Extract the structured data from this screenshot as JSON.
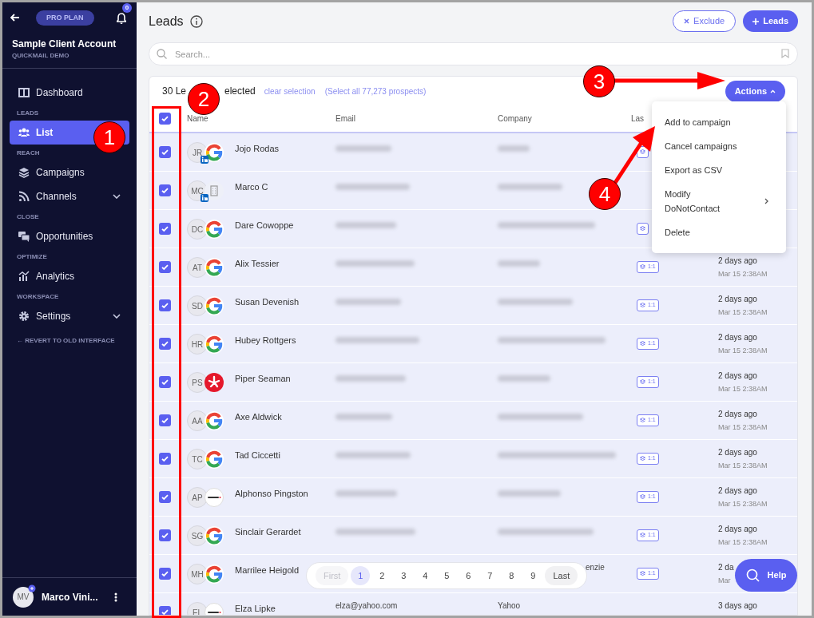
{
  "sidebar": {
    "plan": "PRO PLAN",
    "notifications": "0",
    "account": "Sample Client Account",
    "workspace": "QUICKMAIL DEMO",
    "sections": [
      {
        "items": [
          {
            "kind": "dashboard",
            "label": "Dashboard",
            "selected": false,
            "expandable": false
          }
        ]
      },
      {
        "heading": "LEADS",
        "items": [
          {
            "kind": "list",
            "label": "List",
            "selected": true,
            "expandable": false
          }
        ]
      },
      {
        "heading": "REACH",
        "items": [
          {
            "kind": "campaigns",
            "label": "Campaigns",
            "selected": false,
            "expandable": false
          },
          {
            "kind": "channels",
            "label": "Channels",
            "selected": false,
            "expandable": true
          }
        ]
      },
      {
        "heading": "CLOSE",
        "items": [
          {
            "kind": "opportunities",
            "label": "Opportunities",
            "selected": false,
            "expandable": false
          }
        ]
      },
      {
        "heading": "OPTIMIZE",
        "items": [
          {
            "kind": "analytics",
            "label": "Analytics",
            "selected": false,
            "expandable": false
          }
        ]
      },
      {
        "heading": "WORKSPACE",
        "items": [
          {
            "kind": "settings",
            "label": "Settings",
            "selected": false,
            "expandable": true
          }
        ]
      }
    ],
    "revert_link": "← REVERT TO OLD INTERFACE",
    "user": {
      "initials": "MV",
      "name": "Marco Vini..."
    }
  },
  "page": {
    "title": "Leads",
    "exclude_button": "Exclude",
    "add_button": "Leads",
    "search": {
      "placeholder": "Search..."
    }
  },
  "table": {
    "selection_text": [
      "30 Le",
      "elected"
    ],
    "clear_link": "clear selection",
    "select_all_link": "(Select all 77,273 prospects)",
    "actions_button": "Actions",
    "all_checked": true,
    "columns": [
      "Name",
      "Email",
      "Company",
      "Las"
    ],
    "rows": [
      {
        "checked": true,
        "initials": "JR",
        "name": "Jojo Rodas",
        "logo": {
          "kind": "google"
        },
        "linkedin": true,
        "has_badge": true
      },
      {
        "checked": true,
        "initials": "MC",
        "name": "Marco C",
        "logo": {
          "kind": "building"
        },
        "linkedin": true,
        "has_badge": false
      },
      {
        "checked": true,
        "initials": "DC",
        "name": "Dare Cowoppe",
        "logo": {
          "kind": "google"
        },
        "linkedin": false,
        "has_badge": true
      },
      {
        "checked": true,
        "initials": "AT",
        "name": "Alix Tessier",
        "logo": {
          "kind": "google"
        },
        "linkedin": false,
        "has_badge": true,
        "badge": "1:1",
        "date": "2 days ago",
        "time": "Mar 15 2:38AM"
      },
      {
        "checked": true,
        "initials": "SD",
        "name": "Susan Devenish",
        "logo": {
          "kind": "google"
        },
        "linkedin": false,
        "has_badge": true,
        "badge": "1:1",
        "date": "2 days ago",
        "time": "Mar 15 2:38AM"
      },
      {
        "checked": true,
        "initials": "HR",
        "name": "Hubey Rottgers",
        "logo": {
          "kind": "google"
        },
        "linkedin": false,
        "has_badge": true,
        "badge": "1:1",
        "date": "2 days ago",
        "time": "Mar 15 2:38AM"
      },
      {
        "checked": true,
        "initials": "PS",
        "name": "Piper Seaman",
        "logo": {
          "kind": "yelp"
        },
        "linkedin": false,
        "has_badge": true,
        "badge": "1:1",
        "date": "2 days ago",
        "time": "Mar 15 2:38AM"
      },
      {
        "checked": true,
        "initials": "AA",
        "name": "Axe Aldwick",
        "logo": {
          "kind": "google"
        },
        "linkedin": false,
        "has_badge": true,
        "badge": "1:1",
        "date": "2 days ago",
        "time": "Mar 15 2:38AM"
      },
      {
        "checked": true,
        "initials": "TC",
        "name": "Tad Ciccetti",
        "logo": {
          "kind": "google"
        },
        "linkedin": false,
        "has_badge": true,
        "badge": "1:1",
        "date": "2 days ago",
        "time": "Mar 15 2:38AM"
      },
      {
        "checked": true,
        "initials": "AP",
        "name": "Alphonso Pingston",
        "logo": {
          "kind": "web"
        },
        "linkedin": false,
        "has_badge": true,
        "badge": "1:1",
        "date": "2 days ago",
        "time": "Mar 15 2:38AM"
      },
      {
        "checked": true,
        "initials": "SG",
        "name": "Sinclair Gerardet",
        "logo": {
          "kind": "google"
        },
        "linkedin": false,
        "has_badge": true,
        "badge": "1:1",
        "date": "2 days ago",
        "time": "Mar 15 2:38AM"
      },
      {
        "checked": true,
        "initials": "MH",
        "name": "Marrilee Heigold",
        "logo": {
          "kind": "google"
        },
        "linkedin": false,
        "has_badge": true,
        "badge": "1:1",
        "company": "enzie",
        "company_covered": true,
        "date": "2 da",
        "time": "Mar"
      },
      {
        "checked": true,
        "initials": "EL",
        "name": "Elza Lipke",
        "logo": {
          "kind": "web"
        },
        "linkedin": false,
        "has_badge": false,
        "email": "elza@yahoo.com",
        "company": "Yahoo",
        "date": "3 days ago"
      }
    ]
  },
  "actions_menu": [
    {
      "label": "Add to campaign",
      "submenu": false
    },
    {
      "label": "Cancel campaigns",
      "submenu": false
    },
    {
      "label": "Export as CSV",
      "submenu": false
    },
    {
      "label": "Modify DoNotContact",
      "submenu": true
    },
    {
      "label": "Delete",
      "submenu": false
    }
  ],
  "pagination": [
    {
      "label": "First",
      "selected": false,
      "disabled": true
    },
    {
      "label": "1",
      "selected": true,
      "disabled": false
    },
    {
      "label": "2",
      "selected": false,
      "disabled": false
    },
    {
      "label": "3",
      "selected": false,
      "disabled": false
    },
    {
      "label": "4",
      "selected": false,
      "disabled": false
    },
    {
      "label": "5",
      "selected": false,
      "disabled": false
    },
    {
      "label": "6",
      "selected": false,
      "disabled": false
    },
    {
      "label": "7",
      "selected": false,
      "disabled": false
    },
    {
      "label": "8",
      "selected": false,
      "disabled": false
    },
    {
      "label": "9",
      "selected": false,
      "disabled": false
    },
    {
      "label": "Last",
      "selected": false,
      "disabled": false
    }
  ],
  "help_button": "Help",
  "annotations": [
    "1",
    "2",
    "3",
    "4"
  ]
}
